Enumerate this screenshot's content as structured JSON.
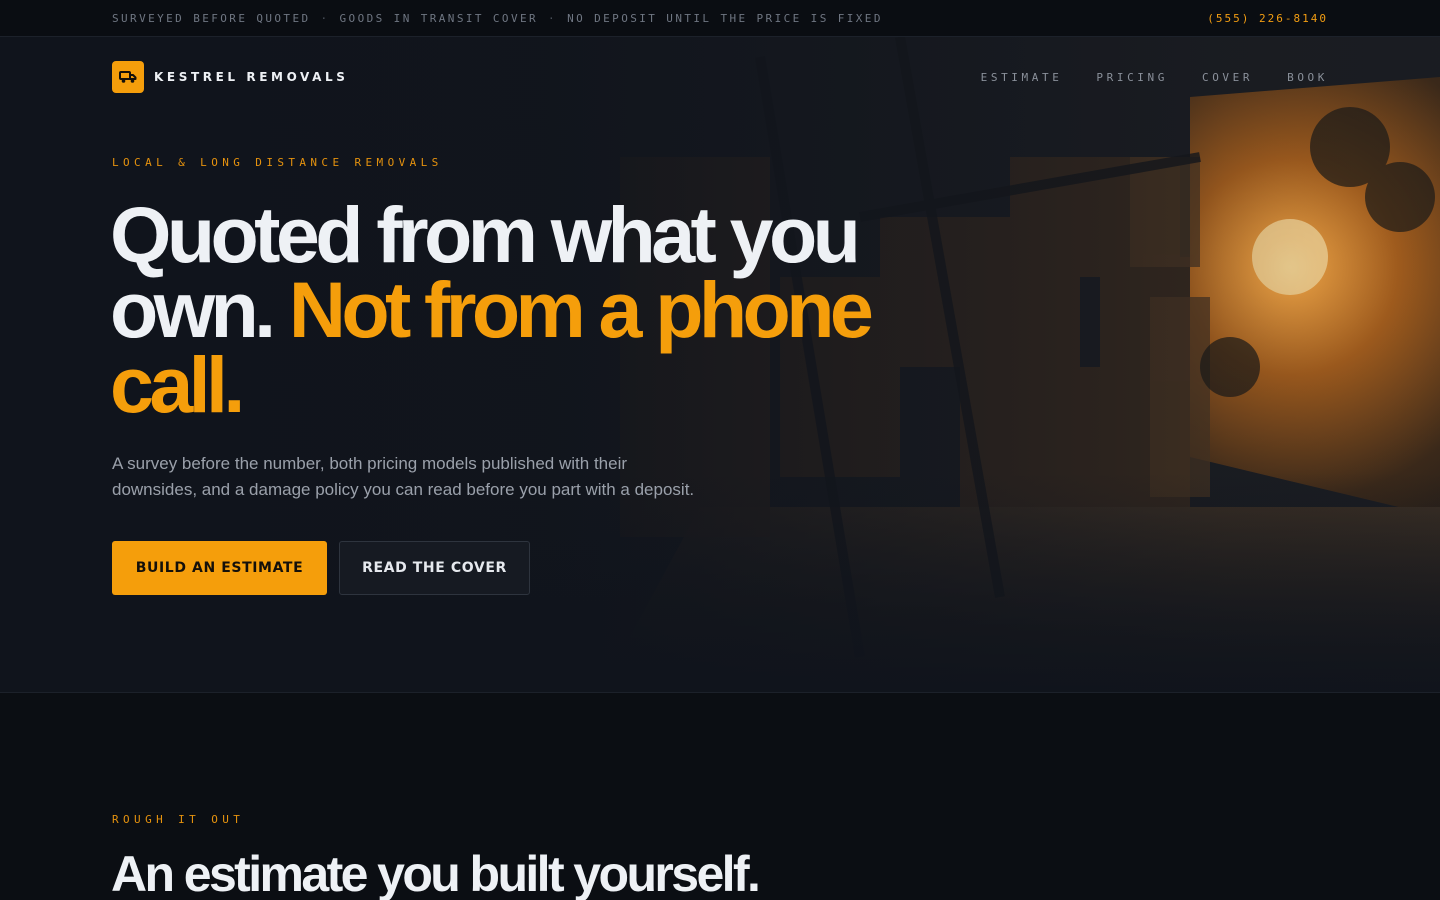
{
  "topbar": {
    "notes": [
      "SURVEYED BEFORE QUOTED",
      "GOODS IN TRANSIT COVER",
      "NO DEPOSIT UNTIL THE PRICE IS FIXED"
    ],
    "separator": "·",
    "phone": "(555) 226-8140"
  },
  "brand": {
    "name": "KESTREL REMOVALS",
    "icon": "truck-icon",
    "accent_color": "#f59e0b"
  },
  "nav": {
    "links": [
      "ESTIMATE",
      "PRICING",
      "COVER",
      "BOOK"
    ]
  },
  "hero": {
    "eyebrow": "LOCAL & LONG DISTANCE REMOVALS",
    "headline_plain": "Quoted from what you own.",
    "headline_accent": "Not from a phone call.",
    "lead": "A survey before the number, both pricing models published with their downsides, and a damage policy you can read before you part with a deposit.",
    "primary_cta": "BUILD AN ESTIMATE",
    "secondary_cta": "READ THE COVER"
  },
  "estimate_section": {
    "eyebrow": "ROUGH IT OUT",
    "title": "An estimate you built yourself."
  }
}
